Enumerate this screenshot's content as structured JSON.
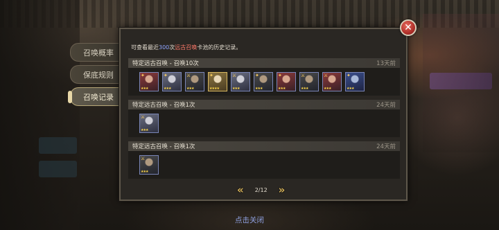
{
  "tabs": [
    {
      "label": "召唤概率",
      "active": false
    },
    {
      "label": "保底规则",
      "active": false
    },
    {
      "label": "召唤记录",
      "active": true
    }
  ],
  "notice": {
    "prefix": "可查看最近",
    "count": "300",
    "count_unit": "次",
    "pool_name": "远古召唤",
    "suffix": "卡池的历史记录。"
  },
  "records": [
    {
      "title": "特定远古召唤 - 召唤10次",
      "time": "13天前",
      "heroes": [
        {
          "style": "red",
          "class_icon": "✦",
          "stars": "★★★"
        },
        {
          "style": "silver",
          "class_icon": "✦",
          "stars": "★★★"
        },
        {
          "style": "dark",
          "class_icon": "⚔",
          "stars": "★★★"
        },
        {
          "style": "gold",
          "class_icon": "✦",
          "stars": "★★★★"
        },
        {
          "style": "silver",
          "class_icon": "⚔",
          "stars": "★★★"
        },
        {
          "style": "dark",
          "class_icon": "✦",
          "stars": "★★★"
        },
        {
          "style": "red",
          "class_icon": "✦",
          "stars": "★★★"
        },
        {
          "style": "dark",
          "class_icon": "⚔",
          "stars": "★★★"
        },
        {
          "style": "red",
          "class_icon": "⚔",
          "stars": "★★★"
        },
        {
          "style": "blue",
          "class_icon": "✦",
          "stars": "★★★"
        }
      ]
    },
    {
      "title": "特定远古召唤 - 召唤1次",
      "time": "24天前",
      "heroes": [
        {
          "style": "silver",
          "class_icon": "⚔",
          "stars": "★★★"
        }
      ]
    },
    {
      "title": "特定远古召唤 - 召唤1次",
      "time": "24天前",
      "heroes": [
        {
          "style": "dark",
          "class_icon": "⚔",
          "stars": "★★★"
        }
      ]
    }
  ],
  "pager": {
    "prev_icon": "double-chevron-left-icon",
    "next_icon": "double-chevron-right-icon",
    "label": "2/12"
  },
  "tap_to_close": "点击关闭",
  "colors": {
    "count_highlight": "#8fa4ff",
    "pool_highlight": "#ff7a6a",
    "tap_to_close": "#8ea0e0",
    "arrow": "#d8b45a"
  }
}
